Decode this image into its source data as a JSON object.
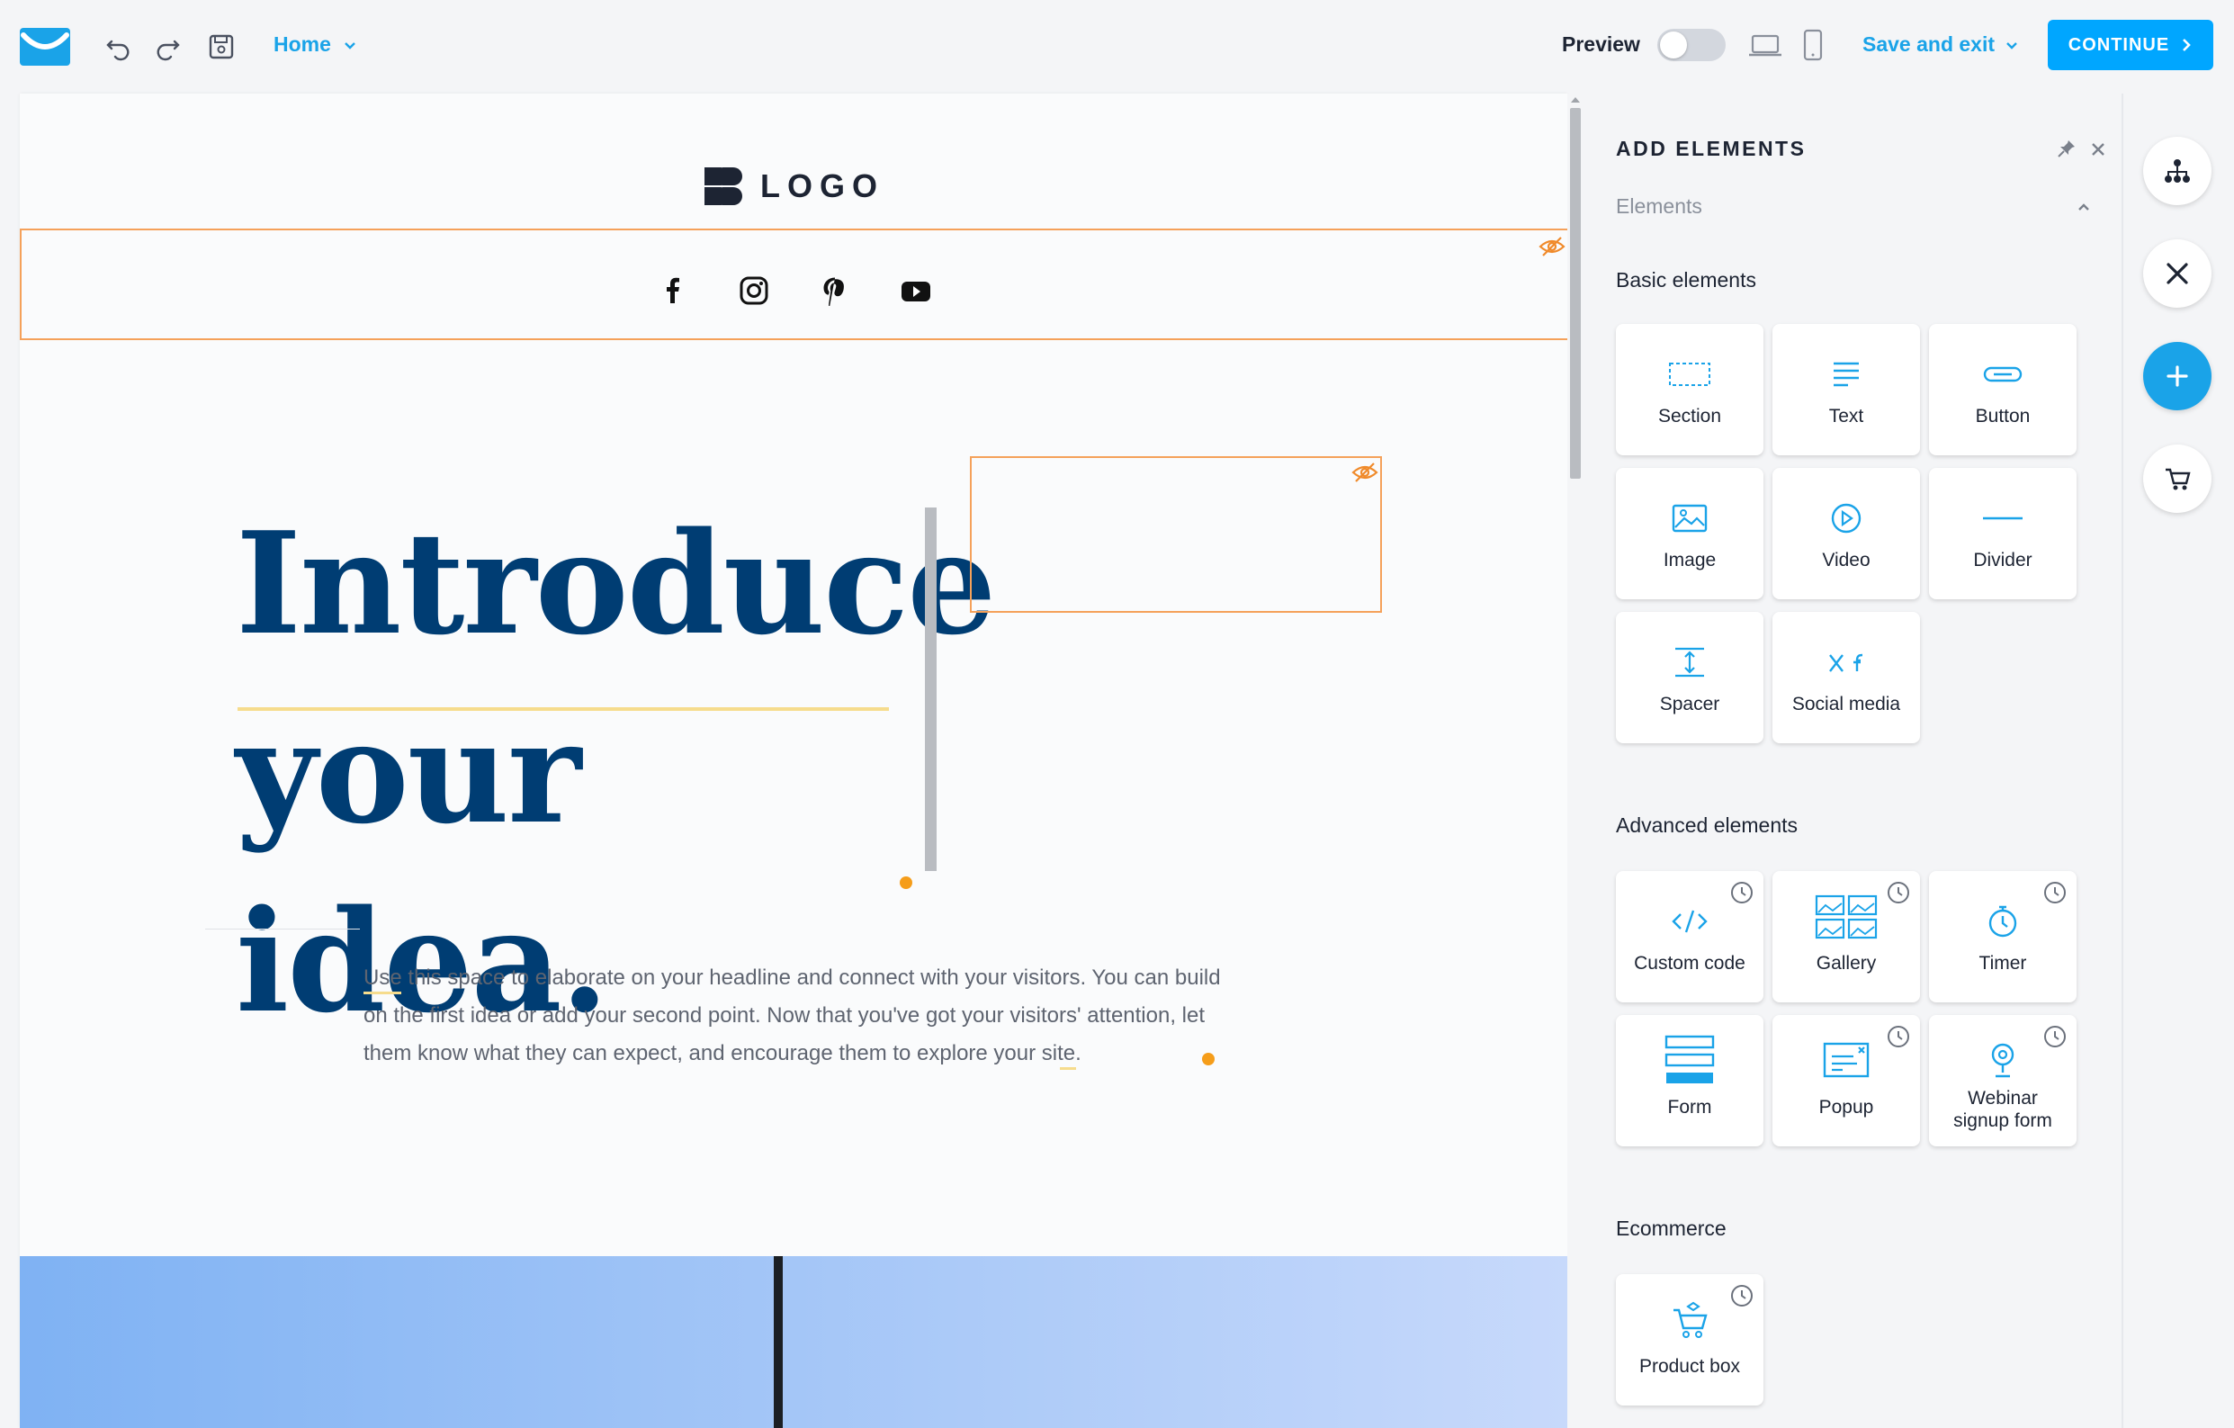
{
  "topbar": {
    "home_label": "Home",
    "preview_label": "Preview",
    "save_exit_label": "Save and exit",
    "continue_label": "CONTINUE"
  },
  "page": {
    "logo_text": "LOGO",
    "headline_line1": "Introduce",
    "headline_line2": "your idea.",
    "body_text": "Use this space to elaborate on your headline and connect with your visitors. You can build on the first idea or add your second point. Now that you've got your visitors' attention, let them know what they can expect, and encourage them to explore your site."
  },
  "panel": {
    "title": "ADD ELEMENTS",
    "group_label": "Elements",
    "basic_heading": "Basic elements",
    "basic": [
      {
        "label": "Section",
        "icon": "section-icon"
      },
      {
        "label": "Text",
        "icon": "text-icon"
      },
      {
        "label": "Button",
        "icon": "button-icon"
      },
      {
        "label": "Image",
        "icon": "image-icon"
      },
      {
        "label": "Video",
        "icon": "video-icon"
      },
      {
        "label": "Divider",
        "icon": "divider-icon"
      },
      {
        "label": "Spacer",
        "icon": "spacer-icon"
      },
      {
        "label": "Social media",
        "icon": "social-media-icon"
      }
    ],
    "advanced_heading": "Advanced elements",
    "advanced": [
      {
        "label": "Custom code",
        "icon": "code-icon"
      },
      {
        "label": "Gallery",
        "icon": "gallery-icon"
      },
      {
        "label": "Timer",
        "icon": "timer-icon"
      },
      {
        "label": "Form",
        "icon": "form-icon"
      },
      {
        "label": "Popup",
        "icon": "popup-icon"
      },
      {
        "label": "Webinar signup form",
        "icon": "webinar-icon"
      }
    ],
    "ecommerce_heading": "Ecommerce",
    "ecommerce": [
      {
        "label": "Product box",
        "icon": "product-box-icon"
      }
    ]
  },
  "colors": {
    "accent": "#1aa3e8",
    "continue_bg": "#00a6ff",
    "headline": "#003d73",
    "hidden_outline": "#f5a15a"
  }
}
